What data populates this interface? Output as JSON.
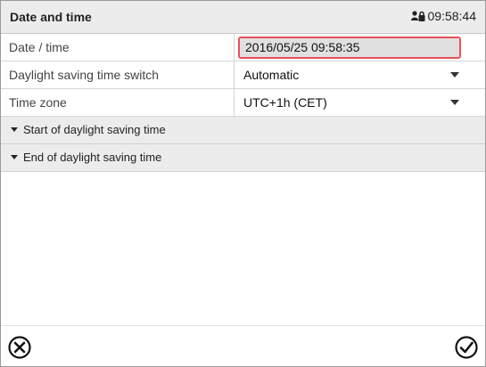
{
  "header": {
    "title": "Date and time",
    "time": "09:58:44",
    "status_icon": "user-lock-icon"
  },
  "rows": [
    {
      "label": "Date / time",
      "value": "2016/05/25 09:58:35",
      "type": "input"
    },
    {
      "label": "Daylight saving time switch",
      "value": "Automatic",
      "type": "select"
    },
    {
      "label": "Time zone",
      "value": "UTC+1h (CET)",
      "type": "select"
    }
  ],
  "sections": [
    {
      "label": "Start of daylight saving time",
      "icon": "caret-down-icon"
    },
    {
      "label": "End of daylight saving time",
      "icon": "caret-down-icon"
    }
  ],
  "footer": {
    "cancel_icon": "cancel-circle-icon",
    "confirm_icon": "confirm-check-icon"
  },
  "colors": {
    "header_bg": "#ececec",
    "section_bg": "#ececec",
    "focus_border": "#e8505b",
    "input_bg": "#e0e0e0"
  }
}
